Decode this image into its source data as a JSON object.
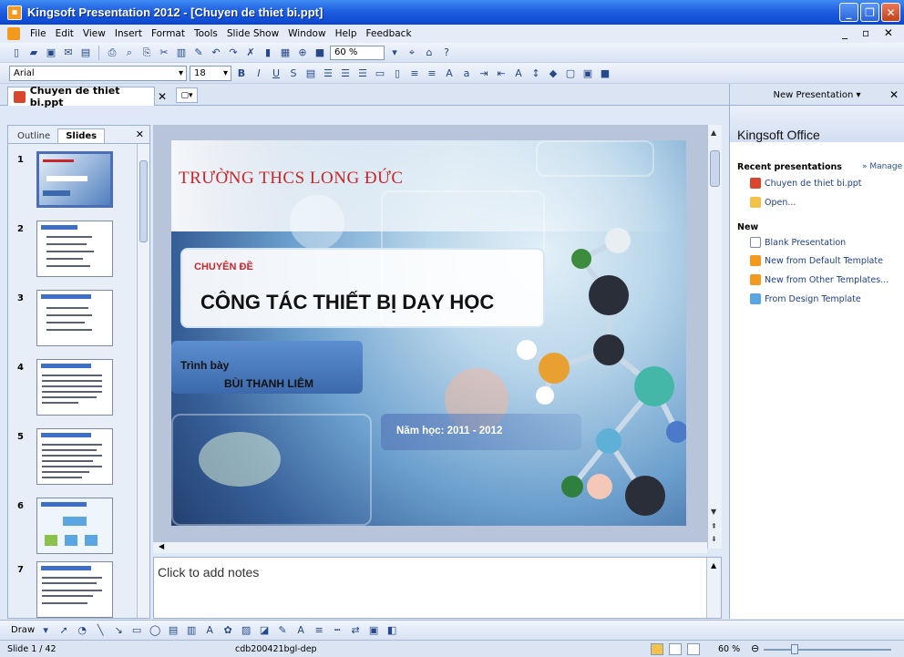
{
  "window": {
    "title": "Kingsoft Presentation 2012 - [Chuyen de thiet bi.ppt]"
  },
  "menu": {
    "items": [
      "File",
      "Edit",
      "View",
      "Insert",
      "Format",
      "Tools",
      "Slide Show",
      "Window",
      "Help",
      "Feedback"
    ]
  },
  "toolbar": {
    "zoom": "60 %",
    "font_name": "Arial",
    "font_size": "18"
  },
  "document_tab": {
    "label": "Chuyen de thiet bi.ppt"
  },
  "left_pane": {
    "tabs": [
      "Outline",
      "Slides"
    ],
    "active_tab": "Slides",
    "slide_numbers": [
      "1",
      "2",
      "3",
      "4",
      "5",
      "6",
      "7"
    ]
  },
  "slide": {
    "school": "TRƯỜNG THCS LONG ĐỨC",
    "subtitle_label": "CHUYÊN ĐỀ",
    "main_title": "CÔNG TÁC THIẾT BỊ DẠY HỌC",
    "presenter_label": "Trình bày",
    "presenter_name": "BÙI THANH LIÊM",
    "school_year": "Năm học: 2011 - 2012"
  },
  "notes": {
    "placeholder": "Click to add notes"
  },
  "task_pane": {
    "header": "New Presentation",
    "brand": "Kingsoft Office",
    "recent_title": "Recent presentations",
    "manage_link": "» Manage",
    "recent_items": [
      "Chuyen de thiet bi.ppt",
      "Open..."
    ],
    "new_title": "New",
    "new_items": [
      "Blank Presentation",
      "New from Default Template",
      "New from Other Templates...",
      "From Design Template"
    ]
  },
  "drawing_toolbar": {
    "draw_label": "Draw"
  },
  "status": {
    "slide_indicator": "Slide 1 / 42",
    "design_name": "cdb200421bgl-dep",
    "zoom": "60 %"
  },
  "colors": {
    "title_red": "#c8262a",
    "titlebar_blue": "#1f5fe0"
  }
}
